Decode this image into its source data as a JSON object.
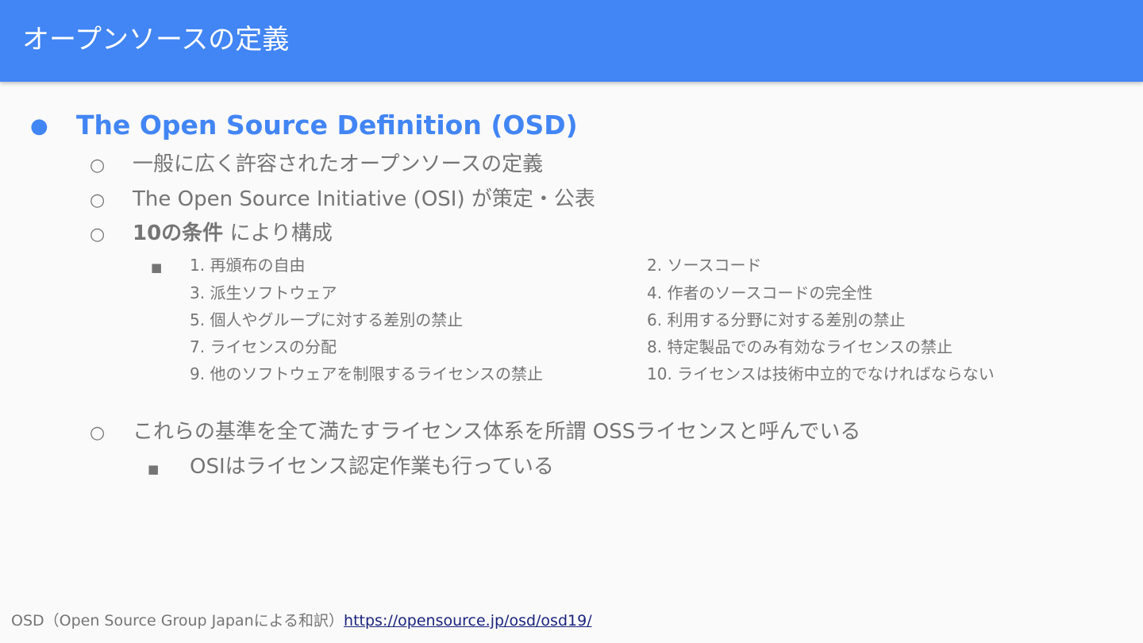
{
  "header": {
    "title": "オープンソースの定義"
  },
  "main": {
    "heading": {
      "bullet": "●",
      "text": "The Open Source Definition (OSD)"
    },
    "points": [
      {
        "bullet": "○",
        "text": "一般に広く許容されたオープンソースの定義"
      },
      {
        "bullet": "○",
        "text": "The Open Source Initiative (OSI) が策定・公表"
      },
      {
        "bullet": "○",
        "bold": "10の条件",
        "text": " により構成"
      }
    ],
    "conditions_bullet": "■",
    "conditions": [
      "1. 再頒布の自由",
      "2. ソースコード",
      "3. 派生ソフトウェア",
      "4. 作者のソースコードの完全性",
      "5. 個人やグループに対する差別の禁止",
      "6. 利用する分野に対する差別の禁止",
      "7. ライセンスの分配",
      "8. 特定製品でのみ有効なライセンスの禁止",
      "9. 他のソフトウェアを制限するライセンスの禁止",
      "10. ライセンスは技術中立的でなければならない"
    ],
    "summary": {
      "bullet": "○",
      "text": "これらの基準を全て満たすライセンス体系を所謂 OSSライセンスと呼んでいる"
    },
    "sub_summary": {
      "bullet": "■",
      "text": "OSIはライセンス認定作業も行っている"
    }
  },
  "footer": {
    "note": "OSD（Open Source Group Japanによる和訳）",
    "link_text": "https://opensource.jp/osd/osd19/"
  },
  "colors": {
    "header_bg": "#4285f4",
    "accent": "#4285f4",
    "body_text": "#757575",
    "link": "#1a237e",
    "background": "#fafafa"
  }
}
